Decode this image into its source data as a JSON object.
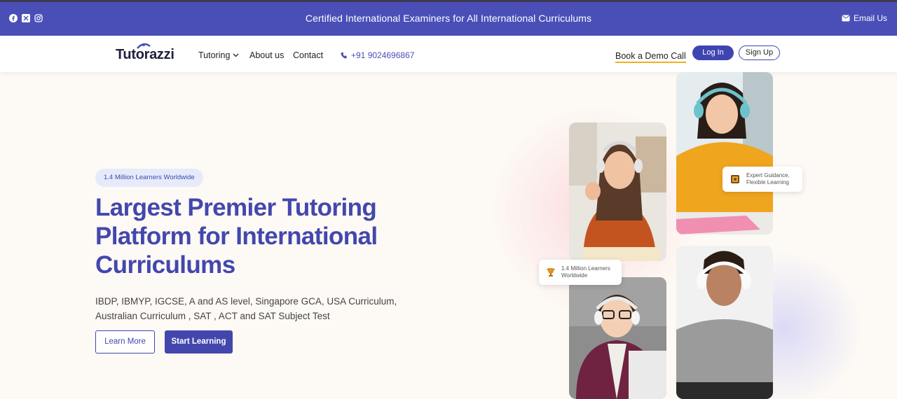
{
  "topbar": {
    "headline": "Certified International Examiners for All International Curriculums",
    "email_label": "Email Us",
    "social": [
      "facebook-icon",
      "x-icon",
      "instagram-icon"
    ]
  },
  "nav": {
    "logo": "Tutorazzi",
    "tutoring": "Tutoring",
    "about": "About us",
    "contact": "Contact",
    "phone": "+91 9024696867",
    "demo": "Book a Demo Call",
    "login": "Log In",
    "signup": "Sign Up"
  },
  "hero": {
    "badge": "1.4 Million Learners Worldwide",
    "title_lines": [
      "Largest Premier Tutoring",
      "Platform for International",
      "Curriculums"
    ],
    "subtitle_line1": "IBDP, IBMYP, IGCSE, A and AS level, Singapore GCA, USA Curriculum,",
    "subtitle_line2": "Australian Curriculum , SAT , ACT and SAT Subject Test",
    "learn_more": "Learn More",
    "start_learning": "Start Learning"
  },
  "cards": {
    "expert_line1": "Expert Guidance,",
    "expert_line2": "Flexible Learning",
    "learners_line1": "1.4 Million Learners",
    "learners_line2": "Worldwide"
  },
  "colors": {
    "primary": "#4347ad",
    "topbar": "#4a4fb8",
    "accent": "#f2b01e",
    "background": "#fdf9f5"
  }
}
